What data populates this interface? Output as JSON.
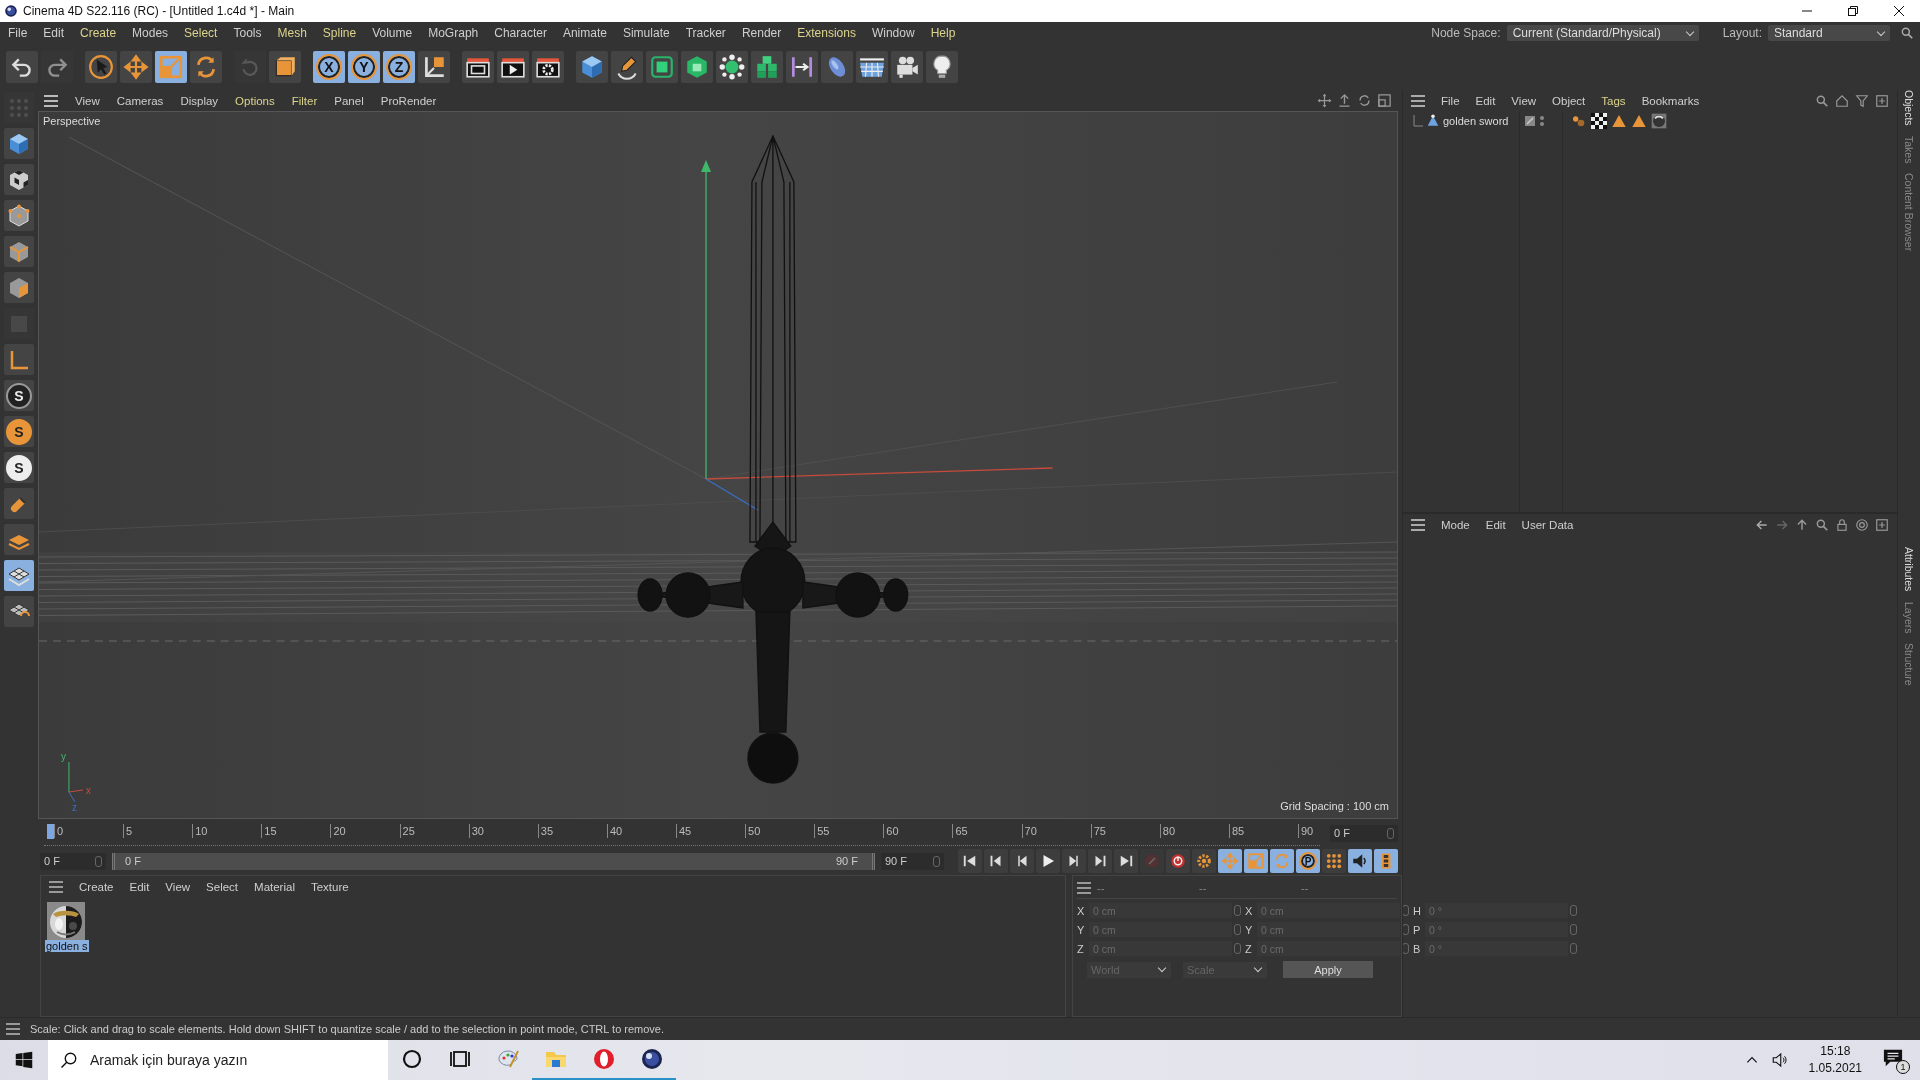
{
  "window": {
    "title": "Cinema 4D S22.116 (RC) - [Untitled 1.c4d *] - Main"
  },
  "menu_bar": [
    {
      "label": "File",
      "accent": false
    },
    {
      "label": "Edit",
      "accent": false
    },
    {
      "label": "Create",
      "accent": true
    },
    {
      "label": "Modes",
      "accent": false
    },
    {
      "label": "Select",
      "accent": true
    },
    {
      "label": "Tools",
      "accent": false
    },
    {
      "label": "Mesh",
      "accent": true
    },
    {
      "label": "Spline",
      "accent": true
    },
    {
      "label": "Volume",
      "accent": false
    },
    {
      "label": "MoGraph",
      "accent": false
    },
    {
      "label": "Character",
      "accent": false
    },
    {
      "label": "Animate",
      "accent": false
    },
    {
      "label": "Simulate",
      "accent": false
    },
    {
      "label": "Tracker",
      "accent": false
    },
    {
      "label": "Render",
      "accent": false
    },
    {
      "label": "Extensions",
      "accent": true
    },
    {
      "label": "Window",
      "accent": false
    },
    {
      "label": "Help",
      "accent": true
    }
  ],
  "node_space": {
    "label": "Node Space:",
    "value": "Current (Standard/Physical)"
  },
  "layout": {
    "label": "Layout:",
    "value": "Standard"
  },
  "toolbar": [
    {
      "kind": "undo",
      "selected": false,
      "disabled": false
    },
    {
      "kind": "redo",
      "selected": false,
      "disabled": true
    },
    {
      "kind": "select",
      "selected": false,
      "disabled": false
    },
    {
      "kind": "move",
      "selected": false,
      "disabled": false
    },
    {
      "kind": "scale",
      "selected": true,
      "disabled": false
    },
    {
      "kind": "rotate",
      "selected": false,
      "disabled": false
    },
    {
      "kind": "recent",
      "selected": false,
      "disabled": true
    },
    {
      "kind": "live",
      "selected": false,
      "disabled": false
    },
    {
      "kind": "axis",
      "label": "X",
      "selected": true,
      "disabled": false
    },
    {
      "kind": "axis",
      "label": "Y",
      "selected": true,
      "disabled": false
    },
    {
      "kind": "axis",
      "label": "Z",
      "selected": true,
      "disabled": false
    },
    {
      "kind": "world",
      "selected": false,
      "disabled": false
    },
    {
      "kind": "clapper",
      "selected": false,
      "disabled": false
    },
    {
      "kind": "clapper-play",
      "selected": false,
      "disabled": false
    },
    {
      "kind": "clapper-gear",
      "selected": false,
      "disabled": false
    },
    {
      "kind": "cube",
      "selected": false,
      "disabled": false
    },
    {
      "kind": "pen",
      "selected": false,
      "disabled": false
    },
    {
      "kind": "subdiv",
      "selected": false,
      "disabled": false
    },
    {
      "kind": "extrude",
      "selected": false,
      "disabled": false
    },
    {
      "kind": "cloner",
      "selected": false,
      "disabled": false
    },
    {
      "kind": "blocks",
      "selected": false,
      "disabled": false
    },
    {
      "kind": "bar",
      "selected": false,
      "disabled": false
    },
    {
      "kind": "deformer",
      "selected": false,
      "disabled": false
    },
    {
      "kind": "floor",
      "selected": false,
      "disabled": false
    },
    {
      "kind": "camera",
      "selected": false,
      "disabled": false
    },
    {
      "kind": "bulb",
      "selected": false,
      "disabled": false
    }
  ],
  "left_tools": [
    {
      "kind": "dots",
      "selected": false,
      "disabled": true
    },
    {
      "kind": "cube",
      "selected": false,
      "disabled": false
    },
    {
      "kind": "checker",
      "selected": false,
      "disabled": false
    },
    {
      "kind": "points",
      "selected": false,
      "disabled": false
    },
    {
      "kind": "edges",
      "selected": false,
      "disabled": false
    },
    {
      "kind": "polys",
      "selected": false,
      "disabled": false
    },
    {
      "kind": "solid",
      "selected": false,
      "disabled": true
    },
    {
      "kind": "lcorner",
      "selected": false,
      "disabled": false
    },
    {
      "kind": "snap",
      "label": "S",
      "selected": false,
      "disabled": false
    },
    {
      "kind": "snap-orange",
      "label": "S",
      "selected": false,
      "disabled": false
    },
    {
      "kind": "snap-white",
      "label": "S",
      "selected": false,
      "disabled": false
    },
    {
      "kind": "magnet",
      "selected": false,
      "disabled": false
    },
    {
      "kind": "plane",
      "selected": false,
      "disabled": false
    },
    {
      "kind": "grid",
      "selected": true,
      "disabled": false
    },
    {
      "kind": "grid-lock",
      "selected": false,
      "disabled": false
    }
  ],
  "viewport": {
    "menu": [
      {
        "label": "View",
        "accent": false
      },
      {
        "label": "Cameras",
        "accent": false
      },
      {
        "label": "Display",
        "accent": false
      },
      {
        "label": "Options",
        "accent": true
      },
      {
        "label": "Filter",
        "accent": true
      },
      {
        "label": "Panel",
        "accent": false
      },
      {
        "label": "ProRender",
        "accent": false
      }
    ],
    "camera": "Perspective",
    "grid_spacing": "Grid Spacing : 100 cm",
    "gizmo_labels": [
      "y",
      "x",
      "z"
    ]
  },
  "timeline": {
    "ticks": [
      "0",
      "5",
      "10",
      "15",
      "20",
      "25",
      "30",
      "35",
      "40",
      "45",
      "50",
      "55",
      "60",
      "65",
      "70",
      "75",
      "80",
      "85",
      "90"
    ],
    "playhead": {
      "level": 0
    },
    "current_frame": "0 F",
    "start_field": "0 F",
    "range": {
      "level": 1
    },
    "range_start": "0 F",
    "range_end": "90 F",
    "end_field": "90 F",
    "controls": [
      {
        "kind": "first",
        "selected": false,
        "disabled": false
      },
      {
        "kind": "prev-key",
        "selected": false,
        "disabled": false
      },
      {
        "kind": "prev",
        "selected": false,
        "disabled": false
      },
      {
        "kind": "play",
        "selected": false,
        "disabled": false
      },
      {
        "kind": "next",
        "selected": false,
        "disabled": false
      },
      {
        "kind": "next-key",
        "selected": false,
        "disabled": false
      },
      {
        "kind": "last",
        "selected": false,
        "disabled": false
      },
      {
        "kind": "record",
        "selected": false,
        "disabled": true
      },
      {
        "kind": "autokey",
        "selected": false,
        "disabled": false
      },
      {
        "kind": "keygear",
        "selected": false,
        "disabled": false
      },
      {
        "kind": "move",
        "selected": true,
        "disabled": false
      },
      {
        "kind": "scale",
        "selected": true,
        "disabled": false
      },
      {
        "kind": "rotate",
        "selected": true,
        "disabled": false
      },
      {
        "kind": "axis",
        "label": "P",
        "selected": true,
        "disabled": false
      },
      {
        "kind": "dotgrid",
        "selected": false,
        "disabled": false
      },
      {
        "kind": "sound",
        "selected": true,
        "disabled": false
      },
      {
        "kind": "filmstrip",
        "selected": true,
        "disabled": false
      }
    ]
  },
  "material_manager": {
    "menu": [
      "Create",
      "Edit",
      "View",
      "Select",
      "Material",
      "Texture"
    ],
    "materials": [
      {
        "name": "golden s",
        "selected": true,
        "kind": "picture"
      }
    ]
  },
  "coordinates": {
    "headers": [
      "--",
      "--",
      "--"
    ],
    "columns": [
      [
        {
          "axis": "X",
          "placeholder": "0 cm"
        },
        {
          "axis": "Y",
          "placeholder": "0 cm"
        },
        {
          "axis": "Z",
          "placeholder": "0 cm"
        }
      ],
      [
        {
          "axis": "X",
          "placeholder": "0 cm"
        },
        {
          "axis": "Y",
          "placeholder": "0 cm"
        },
        {
          "axis": "Z",
          "placeholder": "0 cm"
        }
      ],
      [
        {
          "axis": "H",
          "placeholder": "0 °"
        },
        {
          "axis": "P",
          "placeholder": "0 °"
        },
        {
          "axis": "B",
          "placeholder": "0 °"
        }
      ]
    ],
    "dropdowns": [
      "World",
      "Scale"
    ],
    "apply": "Apply"
  },
  "object_manager": {
    "menu": [
      {
        "label": "File",
        "accent": false
      },
      {
        "label": "Edit",
        "accent": false
      },
      {
        "label": "View",
        "accent": false
      },
      {
        "label": "Object",
        "accent": false
      },
      {
        "label": "Tags",
        "accent": true
      },
      {
        "label": "Bookmarks",
        "accent": false
      }
    ],
    "objects": [
      {
        "name": "golden sword",
        "tags": [
          {
            "kind": "vertexmap"
          },
          {
            "kind": "checker"
          },
          {
            "kind": "triangle"
          },
          {
            "kind": "triangle"
          },
          {
            "kind": "material"
          }
        ]
      }
    ]
  },
  "attributes": {
    "menu": [
      "Mode",
      "Edit",
      "User Data"
    ]
  },
  "side_tabs": [
    {
      "label": "Objects",
      "selected": true
    },
    {
      "label": "Takes",
      "selected": false
    },
    {
      "label": "Content Browser",
      "selected": false
    },
    {
      "label": "Attributes",
      "selected": true
    },
    {
      "label": "Layers",
      "selected": false
    },
    {
      "label": "Structure",
      "selected": false
    }
  ],
  "status_bar": "Scale: Click and drag to scale elements. Hold down SHIFT to quantize scale / add to the selection in point mode, CTRL to remove.",
  "taskbar": {
    "search_placeholder": "Aramak için buraya yazın",
    "apps": [
      {
        "kind": "cortana",
        "active": false
      },
      {
        "kind": "taskview",
        "active": false
      },
      {
        "kind": "paint",
        "active": false
      },
      {
        "kind": "folder",
        "active": true
      },
      {
        "kind": "opera",
        "active": true
      },
      {
        "kind": "c4d",
        "active": true
      }
    ],
    "time": "15:18",
    "date": "1.05.2021",
    "notifications": "1"
  }
}
